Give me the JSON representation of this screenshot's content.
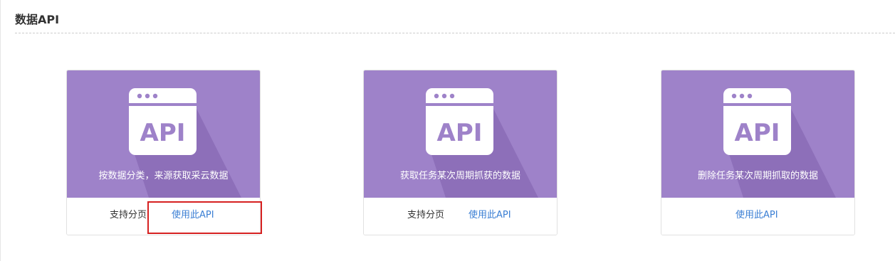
{
  "section": {
    "title": "数据API"
  },
  "cards": [
    {
      "icon_text": "API",
      "description": "按数据分类，来源获取采云数据",
      "paging_label": "支持分页",
      "action_label": "使用此API"
    },
    {
      "icon_text": "API",
      "description": "获取任务某次周期抓获的数据",
      "paging_label": "支持分页",
      "action_label": "使用此API"
    },
    {
      "icon_text": "API",
      "description": "删除任务某次周期抓取的数据",
      "action_label": "使用此API"
    }
  ],
  "colors": {
    "banner": "#9e82c9",
    "link": "#3b7fd4",
    "highlight": "#d62020"
  }
}
